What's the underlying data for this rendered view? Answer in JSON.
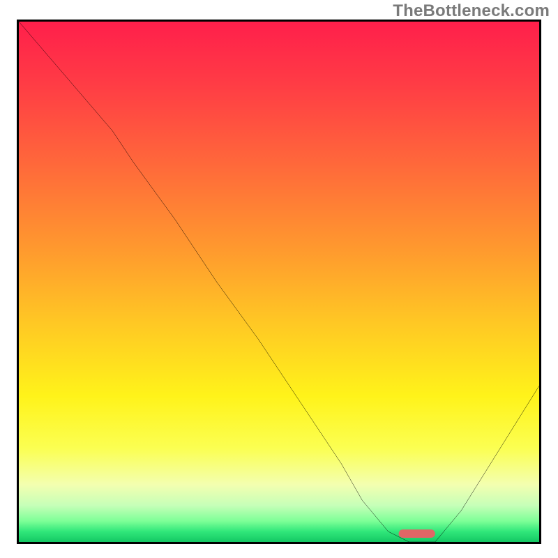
{
  "watermark": "TheBottleneck.com",
  "chart_data": {
    "type": "line",
    "title": "",
    "xlabel": "",
    "ylabel": "",
    "xlim": [
      0,
      100
    ],
    "ylim": [
      0,
      100
    ],
    "grid": false,
    "series": [
      {
        "name": "bottleneck-curve",
        "color": "#000000",
        "x": [
          0,
          6,
          12,
          18,
          22,
          30,
          38,
          46,
          54,
          62,
          66,
          71,
          75,
          80,
          85,
          90,
          95,
          100
        ],
        "y": [
          100,
          93,
          86,
          79,
          73,
          62,
          50,
          39,
          27,
          15,
          8,
          2,
          0,
          0,
          6,
          14,
          22,
          30
        ]
      }
    ],
    "marker": {
      "name": "optimal-range",
      "color": "#e06666",
      "x_start": 73,
      "x_end": 80,
      "y": 0.8,
      "height": 1.6
    }
  }
}
